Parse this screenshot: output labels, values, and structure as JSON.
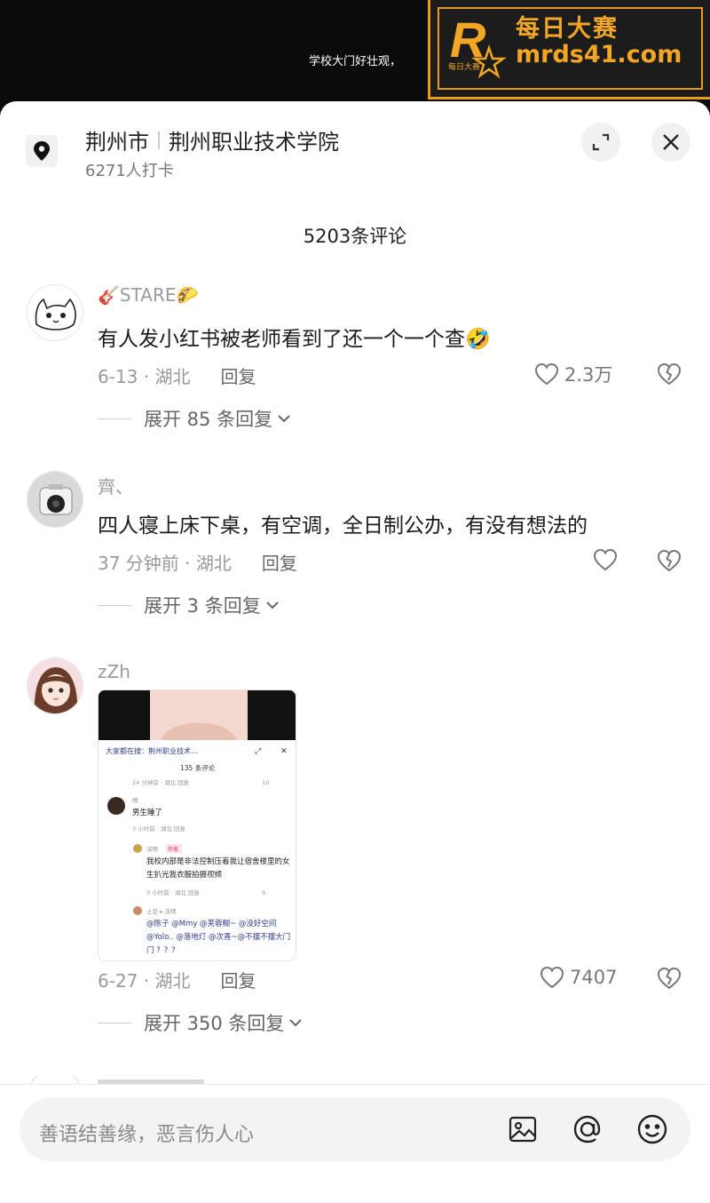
{
  "video": {
    "caption": "学校大门好壮观，"
  },
  "watermark": {
    "line1": "每日大赛",
    "line2": "mrds41.com",
    "logo_letter": "R",
    "logo_small": "每日大赛",
    "accent": "#f2a623"
  },
  "header": {
    "location_city": "荆州市",
    "location_place": "荆州职业技术学院",
    "checkins": "6271人打卡",
    "icons": [
      "location-pin-icon",
      "expand-icon",
      "close-icon"
    ]
  },
  "comments_title": "5203条评论",
  "comments": [
    {
      "username": "🎸STARE🌮",
      "text": "有人发小红书被老师看到了还一个一个查🤣",
      "time": "6-13 · 湖北",
      "reply": "回复",
      "likes": "2.3万",
      "expand": "展开 85 条回复"
    },
    {
      "username": "齊、",
      "text": "四人寝上床下桌，有空调，全日制公办，有没有想法的",
      "time": "37 分钟前 · 湖北",
      "reply": "回复",
      "likes": "",
      "expand": "展开 3 条回复"
    },
    {
      "username": "zZh",
      "text": "",
      "time": "6-27 · 湖北",
      "reply": "回复",
      "likes": "7407",
      "expand": "展开 350 条回复",
      "image": {
        "title": "大家都在搜：荆州职业技术...",
        "count": "135 条评论",
        "row1_meta": "24 分钟前 · 湖北  回复",
        "row1_likes": "10",
        "user1": "晴",
        "user1_text": "男生睡了",
        "user1_meta": "3 小时前 · 湖北  回复",
        "user2": "沫晴",
        "user2_tag": "作者",
        "user2_text": "我校内部是非法控制压着我让宿舍楼里的女生扒光我衣服拍摄视频",
        "user2_meta": "3 小时前 · 湖北  回复",
        "user2_likes": "9",
        "user3": "土豆 ▸ 沫晴",
        "user3_text": "@陈子 @Mmy @芙蓉糊~ @没好空间 @Yolo.. @落地灯 @次喜~@不摆不摆大门门 ？？？"
      }
    }
  ],
  "input": {
    "placeholder": "善语结善缘，恶言伤人心",
    "icons": [
      "image-icon",
      "at-icon",
      "emoji-icon"
    ]
  }
}
